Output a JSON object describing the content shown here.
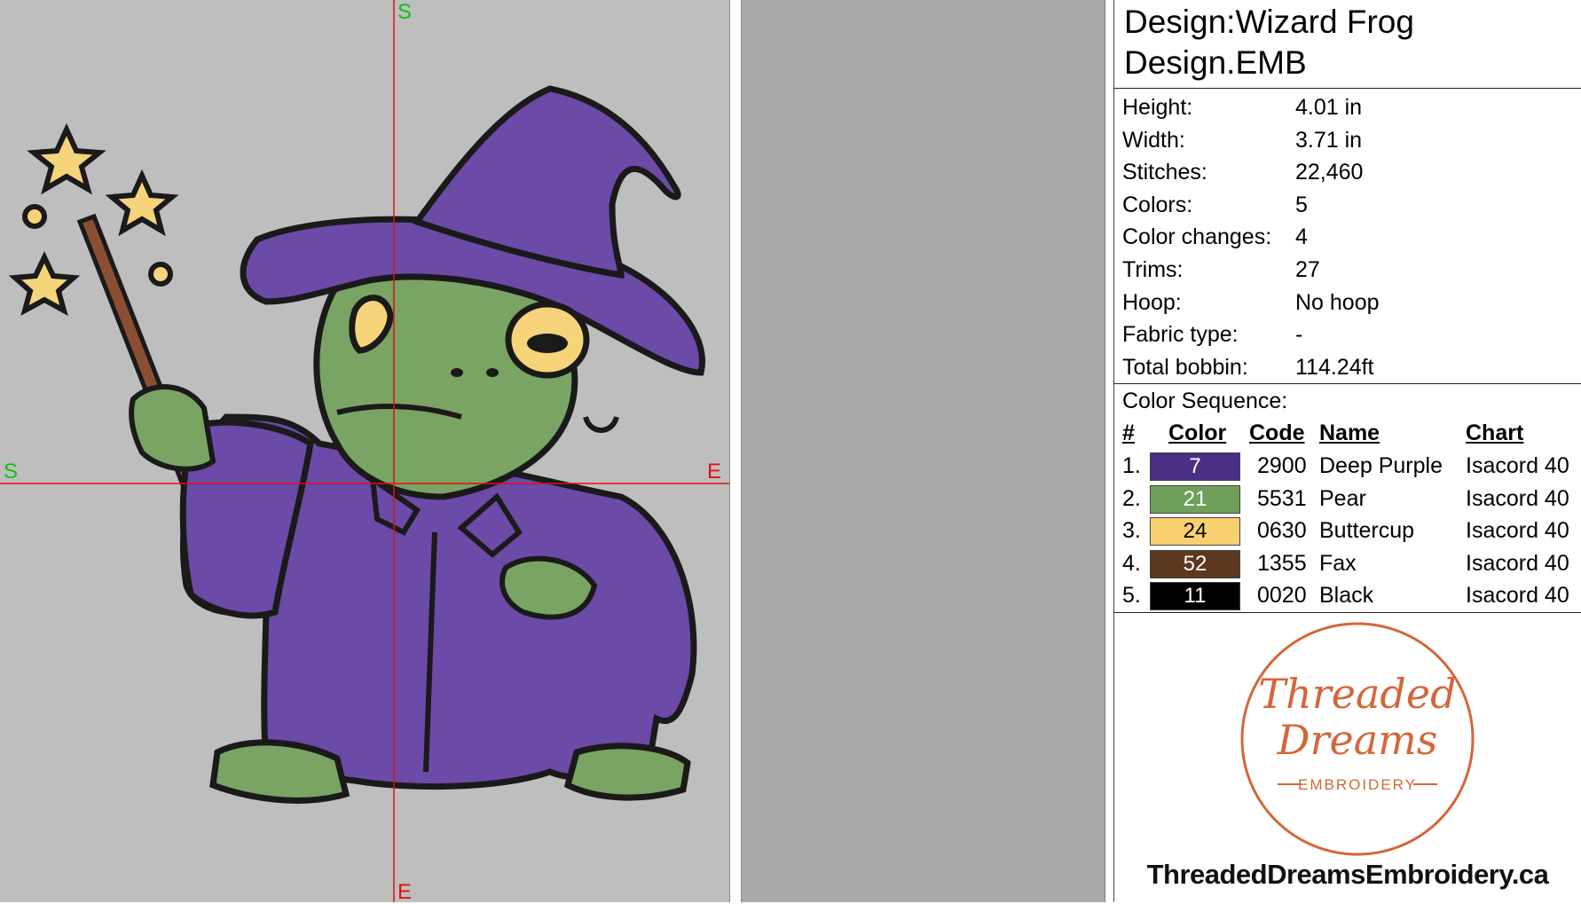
{
  "preview": {
    "axis_labels": {
      "top": "S",
      "bottom": "E",
      "left": "S",
      "right": "E"
    }
  },
  "design": {
    "title_line1": "Design:Wizard Frog",
    "title_line2": "Design.EMB"
  },
  "properties": [
    {
      "label": "Height:",
      "value": "4.01 in"
    },
    {
      "label": "Width:",
      "value": "3.71 in"
    },
    {
      "label": "Stitches:",
      "value": "22,460"
    },
    {
      "label": "Colors:",
      "value": "5"
    },
    {
      "label": "Color changes:",
      "value": "4"
    },
    {
      "label": "Trims:",
      "value": "27"
    },
    {
      "label": "Hoop:",
      "value": "No hoop"
    },
    {
      "label": "Fabric type:",
      "value": "-"
    },
    {
      "label": "Total bobbin:",
      "value": "114.24ft"
    }
  ],
  "color_sequence": {
    "title": "Color Sequence:",
    "headers": {
      "num": "#",
      "color": "Color",
      "code": "Code",
      "name": "Name",
      "chart": "Chart"
    },
    "rows": [
      {
        "num": "1.",
        "swatch": "7",
        "swatch_color": "#4a2f86",
        "text_color": "#ffffff",
        "code": "2900",
        "name": "Deep Purple",
        "chart": "Isacord 40"
      },
      {
        "num": "2.",
        "swatch": "21",
        "swatch_color": "#6f9f5a",
        "text_color": "#ffffff",
        "code": "5531",
        "name": "Pear",
        "chart": "Isacord 40"
      },
      {
        "num": "3.",
        "swatch": "24",
        "swatch_color": "#f9d070",
        "text_color": "#000000",
        "code": "0630",
        "name": "Buttercup",
        "chart": "Isacord 40"
      },
      {
        "num": "4.",
        "swatch": "52",
        "swatch_color": "#5c3820",
        "text_color": "#ffffff",
        "code": "1355",
        "name": "Fax",
        "chart": "Isacord 40"
      },
      {
        "num": "5.",
        "swatch": "11",
        "swatch_color": "#000000",
        "text_color": "#ffffff",
        "code": "0020",
        "name": "Black",
        "chart": "Isacord 40"
      }
    ]
  },
  "logo": {
    "line1": "Threaded",
    "line2": "Dreams",
    "line3": "EMBROIDERY",
    "color": "#d4663a"
  },
  "website": "ThreadedDreamsEmbroidery.ca"
}
